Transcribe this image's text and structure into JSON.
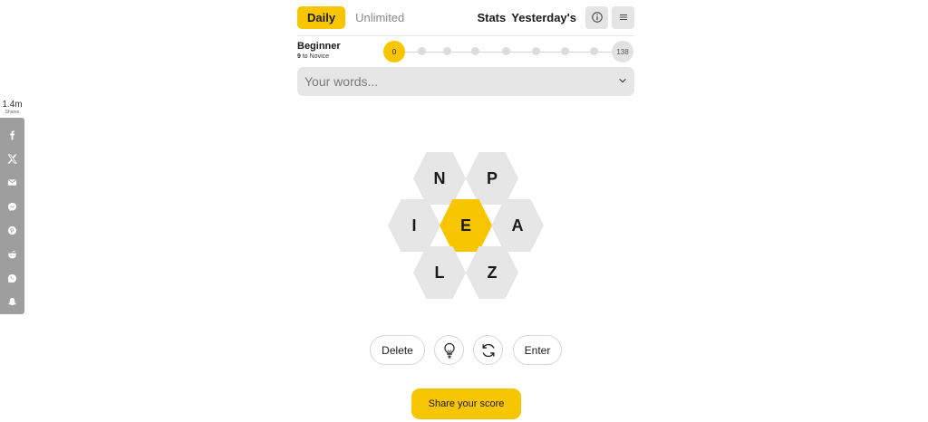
{
  "share": {
    "count": "1.4m",
    "label": "Shares",
    "buttons": [
      "facebook-icon",
      "x-icon",
      "email-icon",
      "messenger-icon",
      "pinterest-icon",
      "reddit-icon",
      "whatsapp-icon",
      "snapchat-icon"
    ]
  },
  "nav": {
    "daily": "Daily",
    "unlimited": "Unlimited",
    "stats": "Stats",
    "yesterdays": "Yesterday's",
    "info_icon": "info-icon",
    "menu_icon": "menu-icon"
  },
  "rank": {
    "title": "Beginner",
    "next_points": "9",
    "next_label": "to Novice",
    "progress_start": "0",
    "progress_end": "138",
    "progress_fraction": 0
  },
  "words": {
    "placeholder": "Your words..."
  },
  "hive": {
    "center": "E",
    "outer": [
      "N",
      "P",
      "I",
      "A",
      "L",
      "Z"
    ]
  },
  "actions": {
    "delete": "Delete",
    "hint_icon": "lightbulb-icon",
    "shuffle_icon": "shuffle-icon",
    "enter": "Enter",
    "share_score": "Share your score"
  },
  "colors": {
    "accent": "#f7c600",
    "cell": "#e6e6e6",
    "share_bar": "#9e9e9e"
  }
}
